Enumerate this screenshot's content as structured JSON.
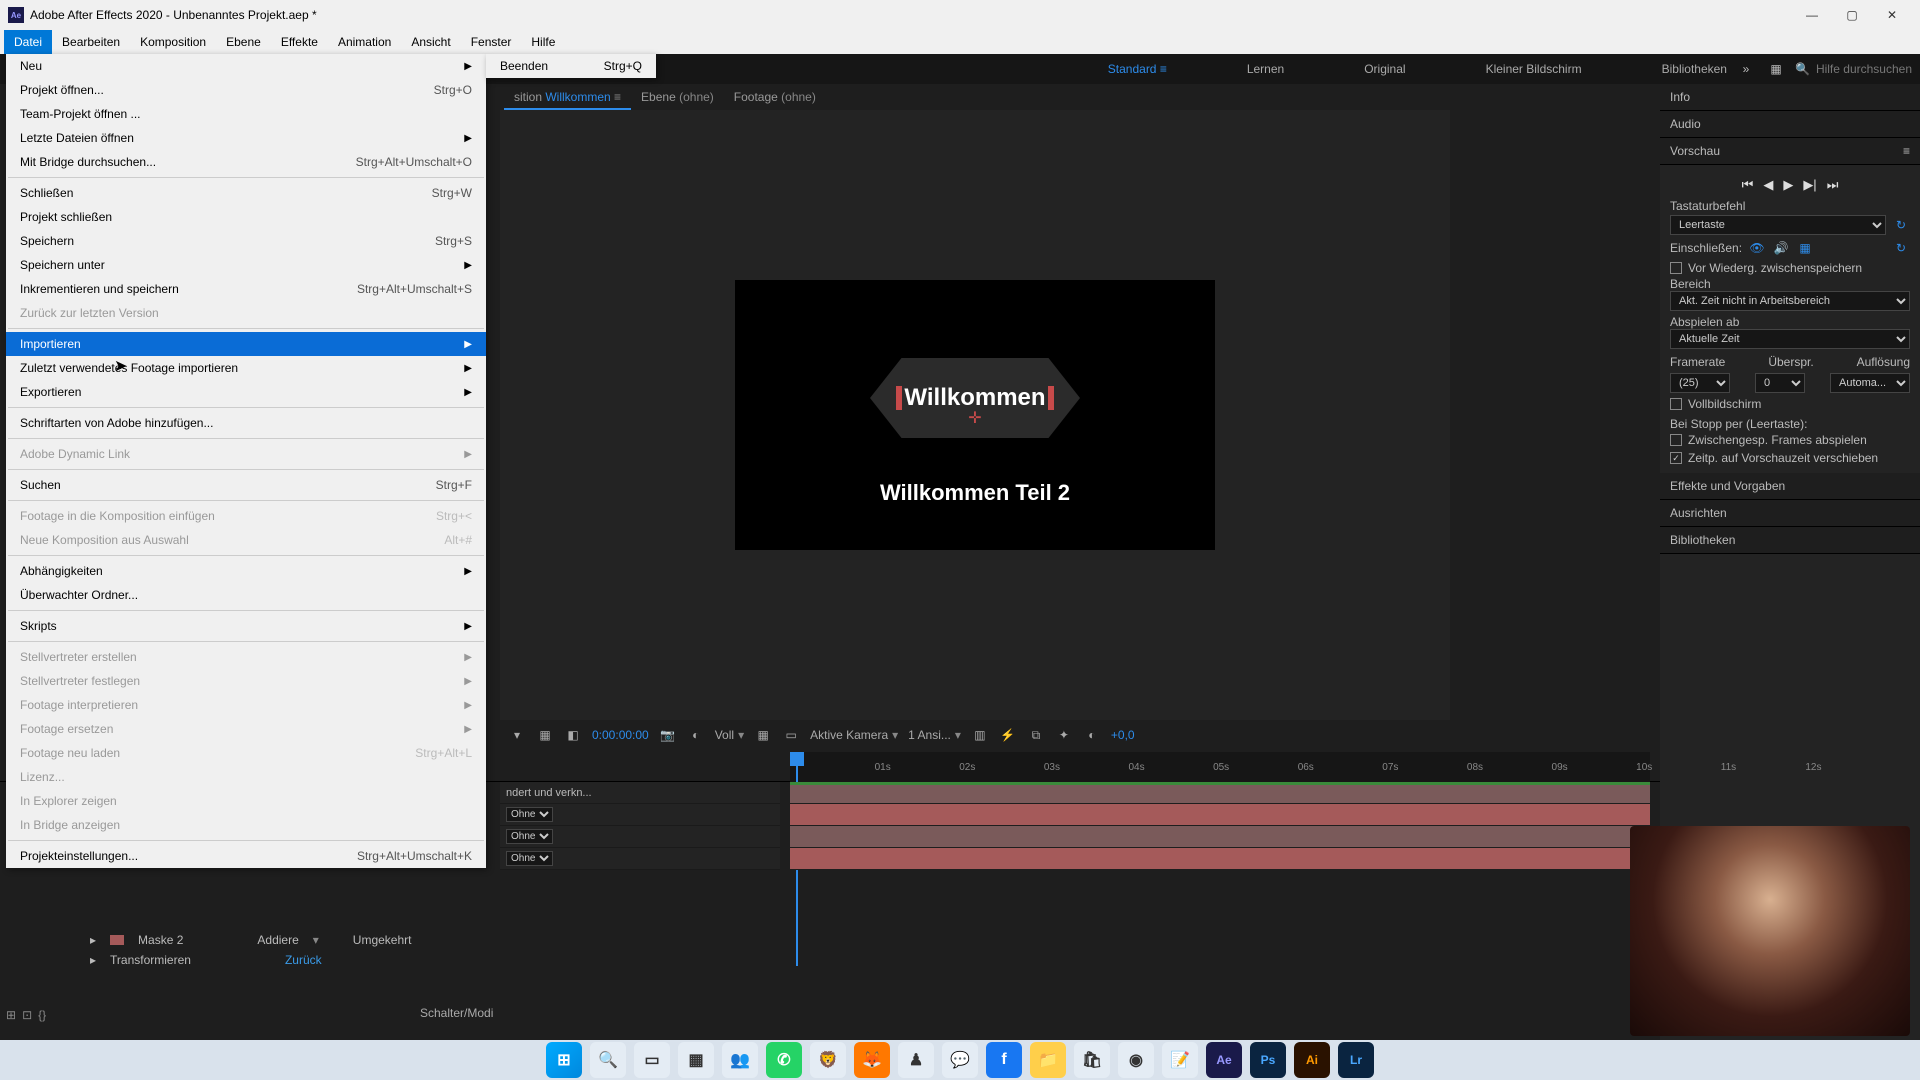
{
  "titlebar": {
    "app_icon_text": "Ae",
    "title": "Adobe After Effects 2020 - Unbenanntes Projekt.aep *"
  },
  "menubar": [
    "Datei",
    "Bearbeiten",
    "Komposition",
    "Ebene",
    "Effekte",
    "Animation",
    "Ansicht",
    "Fenster",
    "Hilfe"
  ],
  "menubar_open_index": 0,
  "file_menu": [
    {
      "label": "Neu",
      "sc": "",
      "sub": true
    },
    {
      "label": "Projekt öffnen...",
      "sc": "Strg+O"
    },
    {
      "label": "Team-Projekt öffnen ..."
    },
    {
      "label": "Letzte Dateien öffnen",
      "sub": true
    },
    {
      "label": "Mit Bridge durchsuchen...",
      "sc": "Strg+Alt+Umschalt+O"
    },
    {
      "sep": true
    },
    {
      "label": "Schließen",
      "sc": "Strg+W"
    },
    {
      "label": "Projekt schließen"
    },
    {
      "label": "Speichern",
      "sc": "Strg+S"
    },
    {
      "label": "Speichern unter",
      "sub": true
    },
    {
      "label": "Inkrementieren und speichern",
      "sc": "Strg+Alt+Umschalt+S"
    },
    {
      "label": "Zurück zur letzten Version",
      "disabled": true
    },
    {
      "sep": true
    },
    {
      "label": "Importieren",
      "sub": true,
      "hover": true
    },
    {
      "label": "Zuletzt verwendetes Footage importieren",
      "sub": true
    },
    {
      "label": "Exportieren",
      "sub": true
    },
    {
      "sep": true
    },
    {
      "label": "Schriftarten von Adobe hinzufügen..."
    },
    {
      "sep": true
    },
    {
      "label": "Adobe Dynamic Link",
      "sub": true,
      "disabled": true
    },
    {
      "sep": true
    },
    {
      "label": "Suchen",
      "sc": "Strg+F"
    },
    {
      "sep": true
    },
    {
      "label": "Footage in die Komposition einfügen",
      "sc": "Strg+<",
      "disabled": true
    },
    {
      "label": "Neue Komposition aus Auswahl",
      "sc": "Alt+#",
      "disabled": true
    },
    {
      "sep": true
    },
    {
      "label": "Abhängigkeiten",
      "sub": true
    },
    {
      "label": "Überwachter Ordner..."
    },
    {
      "sep": true
    },
    {
      "label": "Skripts",
      "sub": true
    },
    {
      "sep": true
    },
    {
      "label": "Stellvertreter erstellen",
      "sub": true,
      "disabled": true
    },
    {
      "label": "Stellvertreter festlegen",
      "sub": true,
      "disabled": true
    },
    {
      "label": "Footage interpretieren",
      "sub": true,
      "disabled": true
    },
    {
      "label": "Footage ersetzen",
      "sub": true,
      "disabled": true
    },
    {
      "label": "Footage neu laden",
      "sc": "Strg+Alt+L",
      "disabled": true
    },
    {
      "label": "Lizenz...",
      "disabled": true
    },
    {
      "label": "In Explorer zeigen",
      "disabled": true
    },
    {
      "label": "In Bridge anzeigen",
      "disabled": true
    },
    {
      "sep": true
    },
    {
      "label": "Projekteinstellungen...",
      "sc": "Strg+Alt+Umschalt+K"
    }
  ],
  "submenu": {
    "label": "Beenden",
    "sc": "Strg+Q"
  },
  "toolbar": {
    "snap_label": "Ausrichten",
    "workspaces": [
      "Standard",
      "Lernen",
      "Original",
      "Kleiner Bildschirm",
      "Bibliotheken"
    ],
    "active_ws": 0,
    "search_placeholder": "Hilfe durchsuchen"
  },
  "comp_tabs": {
    "items": [
      {
        "prefix": "sition ",
        "name": "Willkommen",
        "active": true,
        "menu": true
      },
      {
        "prefix": "Ebene ",
        "name": "(ohne)"
      },
      {
        "prefix": "Footage ",
        "name": "(ohne)"
      }
    ]
  },
  "canvas": {
    "title_text": "Willkommen",
    "subtitle": "Willkommen Teil 2"
  },
  "viewfoot": {
    "timecode": "0:00:00:00",
    "res": "Voll",
    "camera": "Aktive Kamera",
    "views": "1 Ansi...",
    "exposure": "+0,0"
  },
  "right": {
    "info": "Info",
    "audio": "Audio",
    "preview": "Vorschau",
    "shortcut_lbl": "Tastaturbefehl",
    "shortcut_val": "Leertaste",
    "include_lbl": "Einschließen:",
    "precache": "Vor Wiederg. zwischenspeichern",
    "range_lbl": "Bereich",
    "range_val": "Akt. Zeit nicht in Arbeitsbereich",
    "playfrom_lbl": "Abspielen ab",
    "playfrom_val": "Aktuelle Zeit",
    "framerate_lbl": "Framerate",
    "skip_lbl": "Überspr.",
    "res_lbl": "Auflösung",
    "framerate_val": "(25)",
    "skip_val": "0",
    "res_val": "Automa...",
    "fullscreen": "Vollbildschirm",
    "onstop_lbl": "Bei Stopp per (Leertaste):",
    "cached": "Zwischengesp. Frames abspielen",
    "movetime": "Zeitp. auf Vorschauzeit verschieben",
    "effects": "Effekte und Vorgaben",
    "align": "Ausrichten",
    "libs": "Bibliotheken"
  },
  "timeline": {
    "ticks": [
      "01s",
      "02s",
      "03s",
      "04s",
      "05s",
      "06s",
      "07s",
      "08s",
      "09s",
      "10s",
      "11s",
      "12s"
    ],
    "layer_mode": "Ohne",
    "collapsed": "ndert und verkn..."
  },
  "extra": {
    "mask": "Maske 2",
    "blend": "Addiere",
    "inverted": "Umgekehrt",
    "transform": "Transformieren",
    "reset": "Zurück"
  },
  "status": {
    "switcher": "Schalter/Modi"
  },
  "taskbar_apps": [
    "win",
    "search",
    "task",
    "widgets",
    "teams",
    "wa",
    "brave",
    "ff",
    "chess",
    "msg",
    "fb",
    "folder",
    "store",
    "obs",
    "notes",
    "ae",
    "ps",
    "ai",
    "lr"
  ]
}
